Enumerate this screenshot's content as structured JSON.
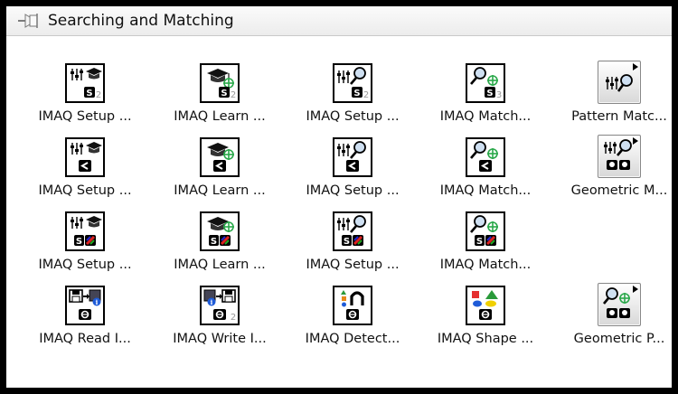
{
  "palette": {
    "title": "Searching and Matching",
    "rows": [
      [
        {
          "label": "IMAQ Setup ...",
          "icon": "setup-template-icon",
          "badge": "2"
        },
        {
          "label": "IMAQ Learn ...",
          "icon": "learn-template-icon",
          "badge": "2"
        },
        {
          "label": "IMAQ Setup ...",
          "icon": "setup-search-icon",
          "badge": "2"
        },
        {
          "label": "IMAQ Match...",
          "icon": "match-pattern-icon",
          "badge": "3"
        },
        {
          "label": "Pattern Matc...",
          "icon": "pattern-matching-subpalette-icon",
          "badge": ""
        }
      ],
      [
        {
          "label": "IMAQ Setup ...",
          "icon": "setup-template-geometric-icon",
          "badge": ""
        },
        {
          "label": "IMAQ Learn ...",
          "icon": "learn-template-geometric-icon",
          "badge": ""
        },
        {
          "label": "IMAQ Setup ...",
          "icon": "setup-search-geometric-icon",
          "badge": ""
        },
        {
          "label": "IMAQ Match...",
          "icon": "match-geometric-icon",
          "badge": ""
        },
        {
          "label": "Geometric M...",
          "icon": "geometric-matching-subpalette-icon",
          "badge": ""
        }
      ],
      [
        {
          "label": "IMAQ Setup ...",
          "icon": "setup-template-color-icon",
          "badge": ""
        },
        {
          "label": "IMAQ Learn ...",
          "icon": "learn-template-color-icon",
          "badge": ""
        },
        {
          "label": "IMAQ Setup ...",
          "icon": "setup-search-color-icon",
          "badge": ""
        },
        {
          "label": "IMAQ Match...",
          "icon": "match-color-icon",
          "badge": ""
        }
      ],
      [
        {
          "label": "IMAQ Read I...",
          "icon": "read-image-info-icon",
          "badge": ""
        },
        {
          "label": "IMAQ Write I...",
          "icon": "write-image-info-icon",
          "badge": "2"
        },
        {
          "label": "IMAQ Detect...",
          "icon": "detect-shapes-icon",
          "badge": ""
        },
        {
          "label": "IMAQ Shape ...",
          "icon": "shape-match-icon",
          "badge": ""
        },
        {
          "label": "Geometric P...",
          "icon": "geometric-pattern-subpalette-icon",
          "badge": ""
        }
      ]
    ]
  }
}
